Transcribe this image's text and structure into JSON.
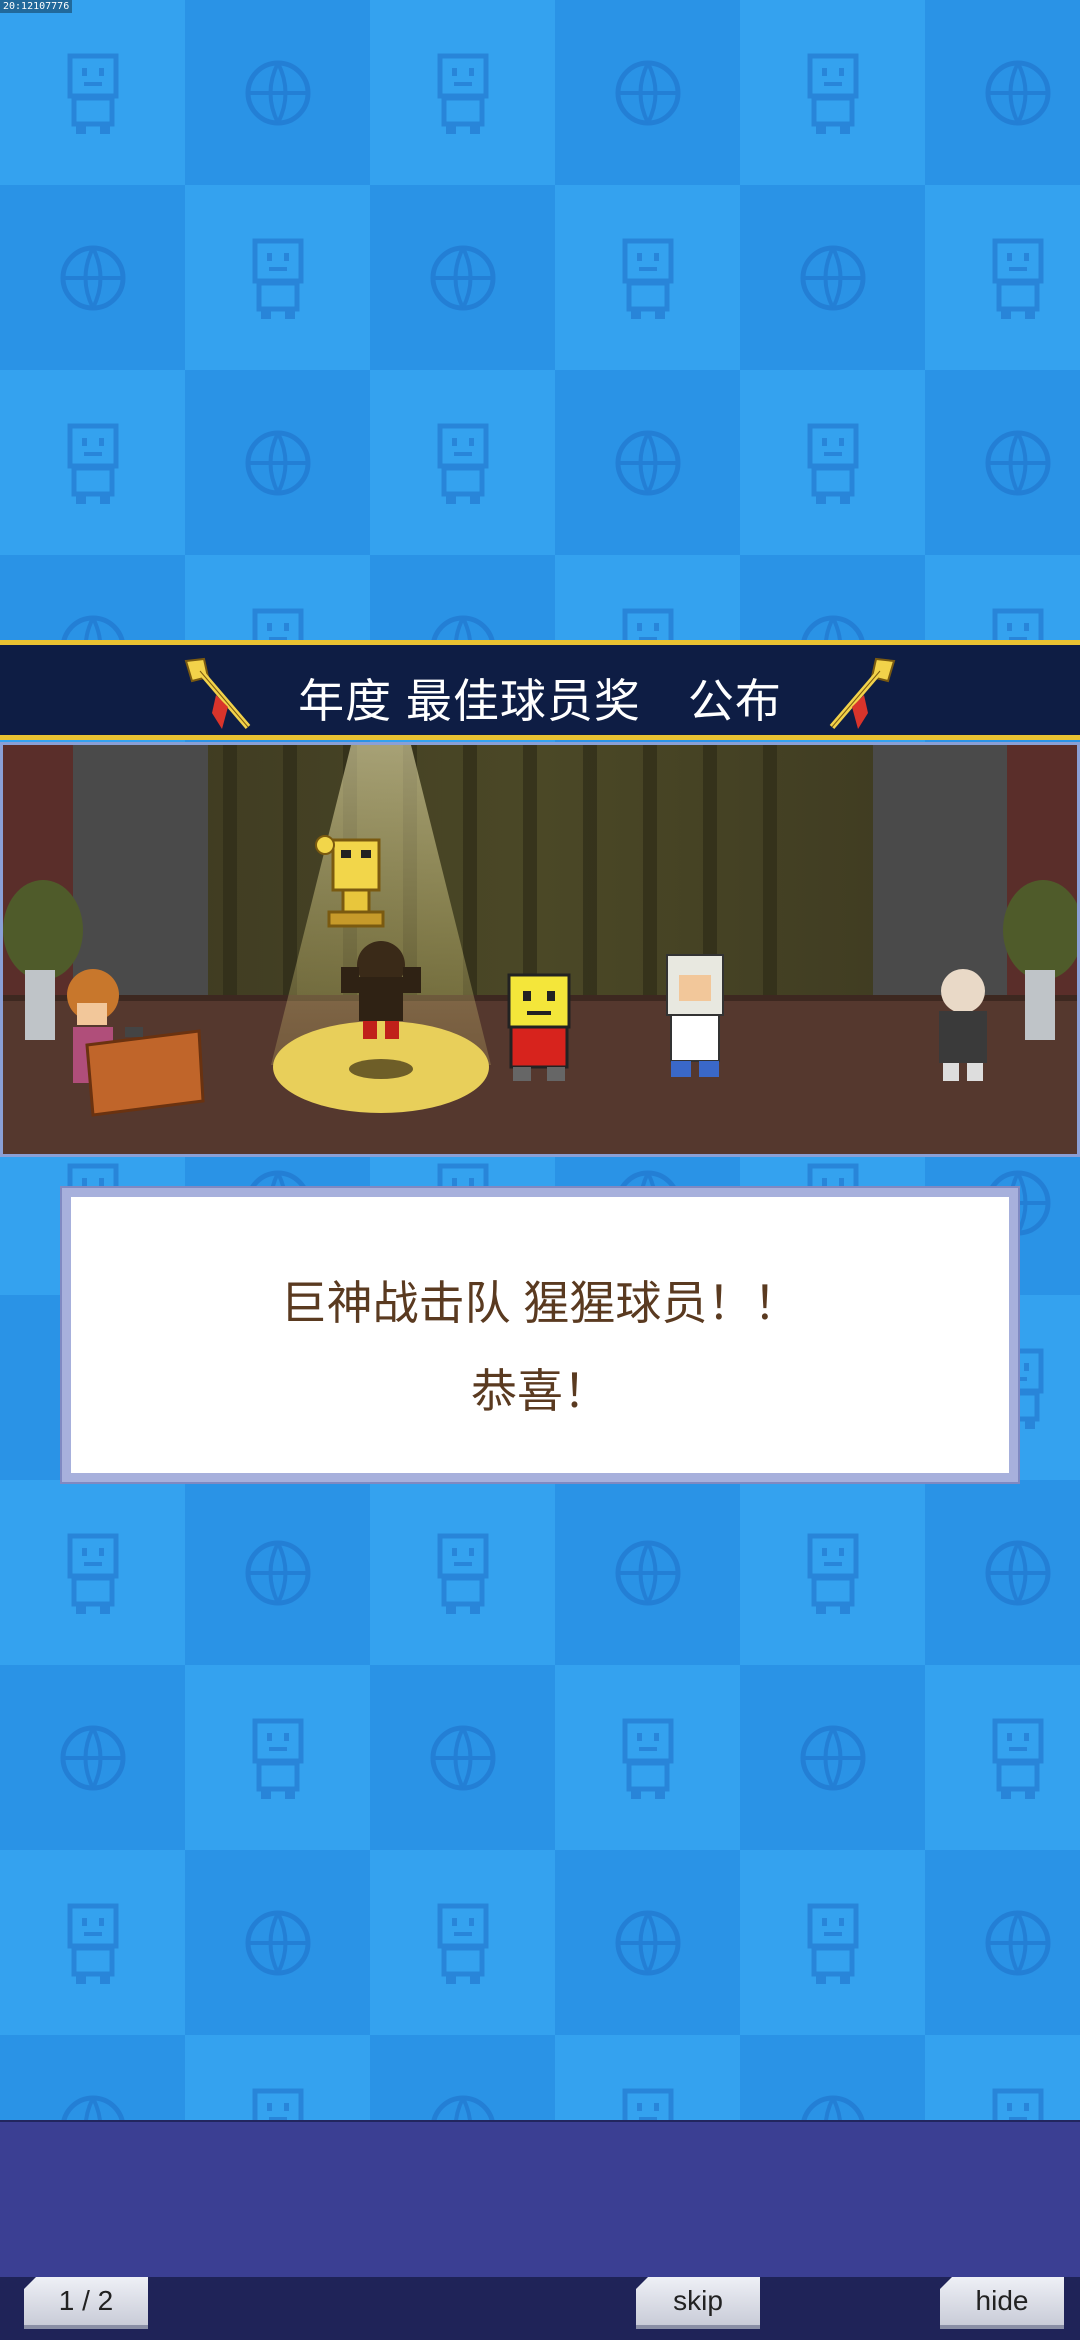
{
  "status_bar": {
    "text": "20:12107776"
  },
  "banner": {
    "title": "年度 最佳球员奖　公布"
  },
  "dialog": {
    "line1": "巨神战击队 猩猩球员！！",
    "line2": "恭喜！"
  },
  "controls": {
    "page_indicator": "1 / 2",
    "skip_label": "skip",
    "hide_label": "hide"
  },
  "colors": {
    "background": "#2f9bec",
    "banner": "#0e1d44",
    "banner_border": "#e9c232",
    "dialog_text": "#5a3a20",
    "bottom_panel": "#3b3f93"
  },
  "icons": [
    "trumpet-icon",
    "trophy-icon",
    "robot-mascot-icon",
    "basketball-icon"
  ]
}
